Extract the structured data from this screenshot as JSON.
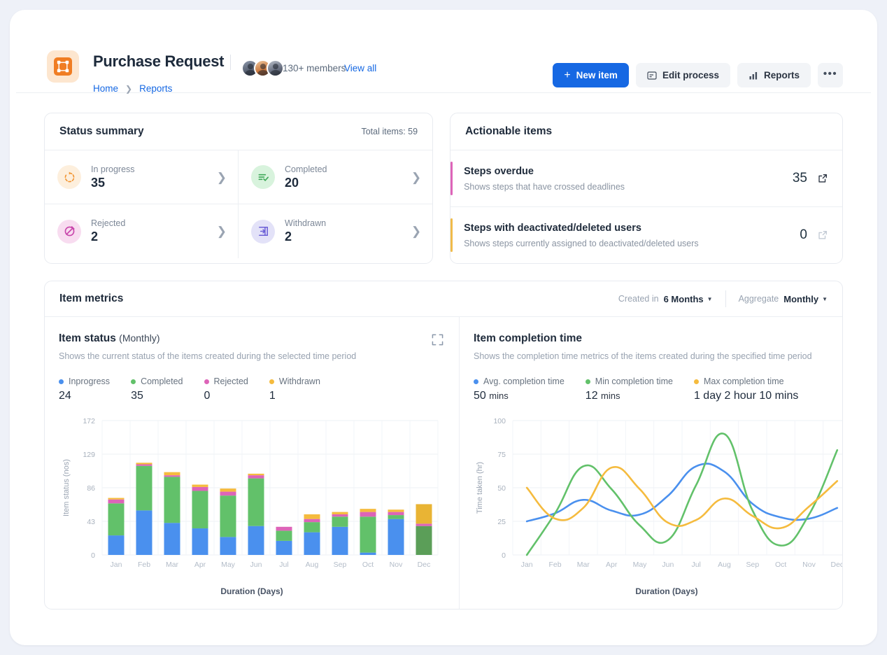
{
  "header": {
    "logo_icon": "network-nodes-icon",
    "title": "Purchase Request",
    "members_text": "130+ members",
    "view_all": "View all",
    "breadcrumb": [
      "Home",
      "Reports"
    ],
    "actions": {
      "new_item": "New item",
      "edit_process": "Edit process",
      "reports": "Reports",
      "more": "•••"
    }
  },
  "status_summary": {
    "title": "Status summary",
    "total_label": "Total items: 59",
    "cells": [
      {
        "label": "In progress",
        "value": "35",
        "icon": "refresh-circle-icon",
        "bg": "#fdefdd",
        "fg": "#f29430"
      },
      {
        "label": "Completed",
        "value": "20",
        "icon": "list-check-icon",
        "bg": "#d8f3dd",
        "fg": "#3fa859"
      },
      {
        "label": "Rejected",
        "value": "2",
        "icon": "block-circle-icon",
        "bg": "#f8dcf0",
        "fg": "#c845ab"
      },
      {
        "label": "Withdrawn",
        "value": "2",
        "icon": "arrow-into-box-icon",
        "bg": "#e3e2f8",
        "fg": "#6b5fd6"
      }
    ]
  },
  "actionable_items": {
    "title": "Actionable items",
    "rows": [
      {
        "title": "Steps overdue",
        "desc": "Shows steps that have crossed deadlines",
        "count": "35",
        "accent": "#dd64b8",
        "link_icon": "external-link-icon",
        "link_active": true
      },
      {
        "title": "Steps with deactivated/deleted users",
        "desc": "Shows steps currently assigned to deactivated/deleted users",
        "count": "0",
        "accent": "#f0bb4a",
        "link_icon": "external-link-icon",
        "link_active": false
      }
    ]
  },
  "item_metrics": {
    "title": "Item metrics",
    "controls": [
      {
        "label": "Created in",
        "value": "6 Months"
      },
      {
        "label": "Aggregate",
        "value": "Monthly"
      }
    ]
  },
  "item_status_panel": {
    "title": "Item status",
    "title_suffix": "(Monthly)",
    "desc": "Shows the current status of the items created during the selected time period",
    "expand_icon": "expand-icon",
    "legend": [
      {
        "name": "Inprogress",
        "value": "24",
        "color": "#4a90ee"
      },
      {
        "name": "Completed",
        "value": "35",
        "color": "#62c16a"
      },
      {
        "name": "Rejected",
        "value": "0",
        "color": "#dd64b8"
      },
      {
        "name": "Withdrawn",
        "value": "1",
        "color": "#f5bb3e"
      }
    ]
  },
  "completion_panel": {
    "title": "Item completion time",
    "desc": "Shows the completion time metrics of the items created during the specified time period",
    "expand_icon": "expand-icon",
    "legend": [
      {
        "name": "Avg. completion time",
        "value": "50",
        "unit": "mins",
        "color": "#4a90ee"
      },
      {
        "name": "Min completion time",
        "value": "12",
        "unit": "mins",
        "color": "#62c16a"
      },
      {
        "name": "Max completion time",
        "value": "1 day 2 hour 10 mins",
        "unit": "",
        "color": "#f5bb3e"
      }
    ]
  },
  "chart_data": [
    {
      "type": "bar",
      "id": "item-status-bar-chart",
      "title": "Item status (Monthly)",
      "stacked": true,
      "xlabel": "Duration (Days)",
      "ylabel": "Item status (nos)",
      "ylim": [
        0,
        172
      ],
      "yticks": [
        0,
        43,
        86,
        129,
        172
      ],
      "grid": true,
      "categories": [
        "Jan",
        "Feb",
        "Mar",
        "Apr",
        "May",
        "Jun",
        "Jul",
        "Aug",
        "Sep",
        "Oct",
        "Nov",
        "Dec"
      ],
      "series": [
        {
          "name": "Inprogress",
          "color": "#4a90ee",
          "values": [
            25,
            57,
            41,
            34,
            23,
            37,
            18,
            29,
            36,
            3,
            46,
            0
          ]
        },
        {
          "name": "Completed",
          "color": "#62c16a",
          "values": [
            41,
            57,
            59,
            48,
            53,
            61,
            13,
            13,
            13,
            46,
            5,
            37
          ]
        },
        {
          "name": "Rejected",
          "color": "#dd64b8",
          "values": [
            5,
            2,
            2,
            5,
            5,
            4,
            5,
            4,
            3,
            6,
            4,
            3
          ]
        },
        {
          "name": "Withdrawn",
          "color": "#f5bb3e",
          "values": [
            2,
            2,
            4,
            3,
            4,
            2,
            0,
            6,
            3,
            4,
            3,
            25
          ]
        }
      ],
      "highlighted_category": "Dec",
      "highlight_colors": {
        "Completed": "#5b9e58",
        "Withdrawn": "#e9b434"
      }
    },
    {
      "type": "line",
      "id": "item-completion-time-line-chart",
      "title": "Item completion time",
      "xlabel": "Duration (Days)",
      "ylabel": "Time taken (hr)",
      "ylim": [
        0,
        100
      ],
      "yticks": [
        0,
        25,
        50,
        75,
        100
      ],
      "grid": true,
      "x": [
        "Jan",
        "Feb",
        "Mar",
        "Apr",
        "May",
        "Jun",
        "Jul",
        "Aug",
        "Sep",
        "Oct",
        "Nov",
        "Dec"
      ],
      "series": [
        {
          "name": "Avg. completion time",
          "color": "#4a90ee",
          "values": [
            25,
            31,
            41,
            33,
            30,
            44,
            66,
            62,
            38,
            28,
            27,
            35
          ]
        },
        {
          "name": "Min completion time",
          "color": "#62c16a",
          "values": [
            0,
            31,
            66,
            49,
            22,
            11,
            52,
            90,
            33,
            7,
            30,
            78
          ]
        },
        {
          "name": "Max completion time",
          "color": "#f5bb3e",
          "values": [
            50,
            27,
            35,
            65,
            49,
            24,
            26,
            42,
            29,
            20,
            36,
            55
          ]
        }
      ]
    }
  ]
}
